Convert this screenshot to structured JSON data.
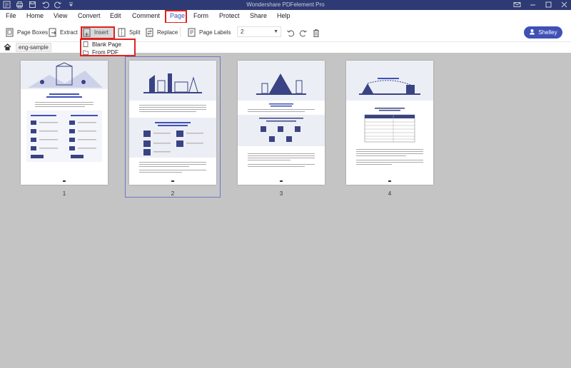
{
  "window": {
    "title": "Wondershare PDFelement Pro"
  },
  "menu": {
    "items": [
      {
        "label": "File"
      },
      {
        "label": "Home"
      },
      {
        "label": "View"
      },
      {
        "label": "Convert"
      },
      {
        "label": "Edit"
      },
      {
        "label": "Comment"
      },
      {
        "label": "Page"
      },
      {
        "label": "Form"
      },
      {
        "label": "Protect"
      },
      {
        "label": "Share"
      },
      {
        "label": "Help"
      }
    ],
    "active": "Page"
  },
  "toolbar": {
    "page_boxes": "Page Boxes",
    "extract": "Extract",
    "insert": "Insert",
    "split": "Split",
    "replace": "Replace",
    "page_labels": "Page Labels",
    "page_select_value": "2",
    "user_name": "Shelley"
  },
  "insert_menu": {
    "blank_page": "Blank Page",
    "from_pdf": "From PDF"
  },
  "breadcrumb": {
    "doc_name": "eng-sample"
  },
  "pages": [
    {
      "number": "1",
      "selected": false
    },
    {
      "number": "2",
      "selected": true
    },
    {
      "number": "3",
      "selected": false
    },
    {
      "number": "4",
      "selected": false
    }
  ],
  "colors": {
    "titlebar": "#2e3a73",
    "accent": "#3f51b5",
    "highlight_outline": "#e02020",
    "workspace": "#c4c4c4"
  }
}
